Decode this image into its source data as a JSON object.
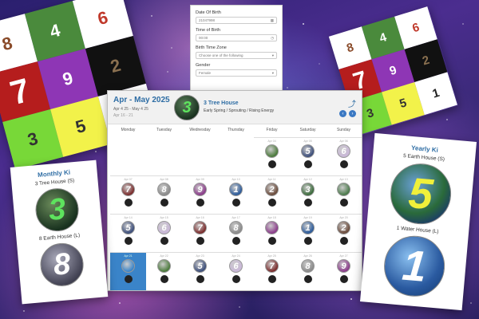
{
  "magic_square_left": {
    "cells": [
      "8",
      "4",
      "6",
      "7",
      "9",
      "2",
      "3",
      "5",
      "1"
    ],
    "colors": [
      "#ffffff",
      "#4a8a3c",
      "#ffffff",
      "#b51d1d",
      "#8e36b5",
      "#111111",
      "#78d838",
      "#f2f24a",
      "#ffffff"
    ],
    "text_colors": [
      "#8a4b2a",
      "#ffffff",
      "#c0392b",
      "#ffffff",
      "#ffffff",
      "#8a7050",
      "#333333",
      "#333333",
      "#222222"
    ]
  },
  "magic_square_right": {
    "cells": [
      "8",
      "4",
      "6",
      "7",
      "9",
      "2",
      "3",
      "5",
      "1"
    ],
    "colors": [
      "#ffffff",
      "#4a8a3c",
      "#ffffff",
      "#b51d1d",
      "#8e36b5",
      "#111111",
      "#78d838",
      "#f2f24a",
      "#ffffff"
    ],
    "text_colors": [
      "#8a4b2a",
      "#ffffff",
      "#c0392b",
      "#ffffff",
      "#ffffff",
      "#8a7050",
      "#333333",
      "#333333",
      "#222222"
    ]
  },
  "form": {
    "date_label": "Date Of Birth",
    "date_value": "21047998",
    "time_label": "Time of Birth",
    "time_value": "00:00",
    "tz_label": "Birth Time Zone",
    "tz_value": "Choose one of the following",
    "gender_label": "Gender",
    "gender_value": "Female"
  },
  "calendar": {
    "title": "Apr - May 2025",
    "range": "Apr 4 25 - May 4 25",
    "sub": "Apr 16 - 21",
    "orb_number": "3",
    "house": "3 Tree House",
    "energy": "Early Spring / Sprouting / Rising Energy",
    "share_icon": "share-icon",
    "days_of_week": [
      "Monday",
      "Tuesday",
      "Wednesday",
      "Thursday",
      "Friday",
      "Saturday",
      "Sunday"
    ],
    "rows": [
      [
        null,
        null,
        null,
        null,
        {
          "d": "Apr 04",
          "n": "",
          "c": "#4a7a3a"
        },
        {
          "d": "Apr 05",
          "n": "5",
          "c": "#3b4d7a"
        },
        {
          "d": "Apr 06",
          "n": "6",
          "c": "#c9b7d8"
        }
      ],
      [
        {
          "d": "Apr 07",
          "n": "7",
          "c": "#7a2a2a"
        },
        {
          "d": "Apr 08",
          "n": "8",
          "c": "#8a8a8a"
        },
        {
          "d": "Apr 09",
          "n": "9",
          "c": "#8a3a8a"
        },
        {
          "d": "Apr 10",
          "n": "1",
          "c": "#2a5a9a"
        },
        {
          "d": "Apr 11",
          "n": "2",
          "c": "#6a4a3a"
        },
        {
          "d": "Apr 12",
          "n": "3",
          "c": "#3a6a3a"
        },
        {
          "d": "Apr 13",
          "n": "",
          "c": "#4a7a4a"
        }
      ],
      [
        {
          "d": "Apr 14",
          "n": "5",
          "c": "#3b4d7a"
        },
        {
          "d": "Apr 15",
          "n": "6",
          "c": "#c9b7d8"
        },
        {
          "d": "Apr 16",
          "n": "7",
          "c": "#7a2a2a"
        },
        {
          "d": "Apr 17",
          "n": "8",
          "c": "#8a8a8a"
        },
        {
          "d": "Apr 18",
          "n": "",
          "c": "#8a3a8a"
        },
        {
          "d": "Apr 19",
          "n": "1",
          "c": "#2a5a9a"
        },
        {
          "d": "Apr 20",
          "n": "2",
          "c": "#6a4a3a"
        }
      ],
      [
        {
          "d": "Apr 21",
          "n": "",
          "c": "#3a84c9",
          "today": true
        },
        {
          "d": "Apr 22",
          "n": "",
          "c": "#4a7a3a"
        },
        {
          "d": "Apr 23",
          "n": "5",
          "c": "#3b4d7a"
        },
        {
          "d": "Apr 24",
          "n": "6",
          "c": "#c9b7d8"
        },
        {
          "d": "Apr 25",
          "n": "7",
          "c": "#7a2a2a"
        },
        {
          "d": "Apr 26",
          "n": "8",
          "c": "#8a8a8a"
        },
        {
          "d": "Apr 27",
          "n": "9",
          "c": "#8a3a8a"
        }
      ]
    ]
  },
  "monthly_ki": {
    "heading": "Monthly Ki",
    "house_primary": "3 Tree House (S)",
    "number_primary": "3",
    "house_secondary": "8 Earth House (L)",
    "number_secondary": "8"
  },
  "yearly_ki": {
    "heading": "Yearly Ki",
    "house_primary": "5 Earth House (S)",
    "number_primary": "5",
    "house_secondary": "1 Water House (L)",
    "number_secondary": "1"
  }
}
